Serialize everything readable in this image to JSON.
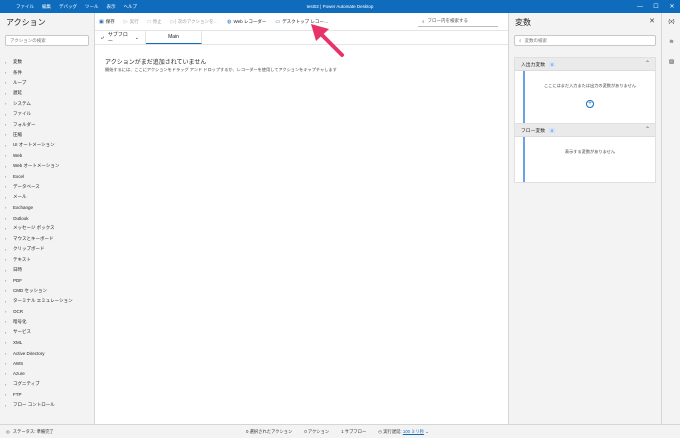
{
  "titlebar": {
    "menu": [
      "ファイル",
      "編集",
      "デバッグ",
      "ツール",
      "表示",
      "ヘルプ"
    ],
    "title": "test02 | Power Automate Desktop",
    "minimize": "—",
    "maximize": "☐",
    "close": "✕"
  },
  "actions_panel": {
    "title": "アクション",
    "search_placeholder": "アクションの検索",
    "items": [
      "変数",
      "条件",
      "ループ",
      "遅延",
      "システム",
      "ファイル",
      "フォルダー",
      "圧縮",
      "UI オートメーション",
      "Web",
      "Web オートメーション",
      "Excel",
      "データベース",
      "メール",
      "Exchange",
      "Outlook",
      "メッセージ ボックス",
      "マウスとキーボード",
      "クリップボード",
      "テキスト",
      "日時",
      "PDF",
      "CMD セッション",
      "ターミナル エミュレーション",
      "OCR",
      "暗号化",
      "サービス",
      "XML",
      "Active Directory",
      "AWS",
      "Azure",
      "コグニティブ",
      "FTP",
      "フロー コントロール"
    ]
  },
  "toolbar": {
    "save": "保存",
    "run": "実行",
    "stop": "停止",
    "next_action": "次のアクションを…",
    "web_recorder": "Web レコーダー",
    "desktop_recorder": "デスクトップ レコー…",
    "search_placeholder": "フロー内を検索する"
  },
  "subflow": {
    "label": "サブフロー",
    "tab_main": "Main"
  },
  "canvas": {
    "empty_title": "アクションがまだ追加されていません",
    "empty_desc": "開始するには、ここにアクションをドラッグ アンド ドロップするか、レコーダーを使用してアクションをキャプチャします"
  },
  "variables_panel": {
    "title": "変数",
    "close": "✕",
    "search_placeholder": "変数の検索",
    "io_section": {
      "label": "入出力変数",
      "count": "0",
      "message": "ここにはまだ入力または出力の変数がありません"
    },
    "flow_section": {
      "label": "フロー変数",
      "count": "0",
      "message": "表示する変数がありません"
    }
  },
  "statusbar": {
    "status": "ステータス: 準備完了",
    "selected_actions": "0 選択されたアクション",
    "actions": "0 アクション",
    "subflows": "1 サブフロー",
    "run_delay_label": "実行遅延",
    "run_delay_value": "100 ミリ秒"
  },
  "colors": {
    "titlebar": "#0f6cbd",
    "accent": "#0f6cbd",
    "annotation_arrow": "#e8336a"
  }
}
